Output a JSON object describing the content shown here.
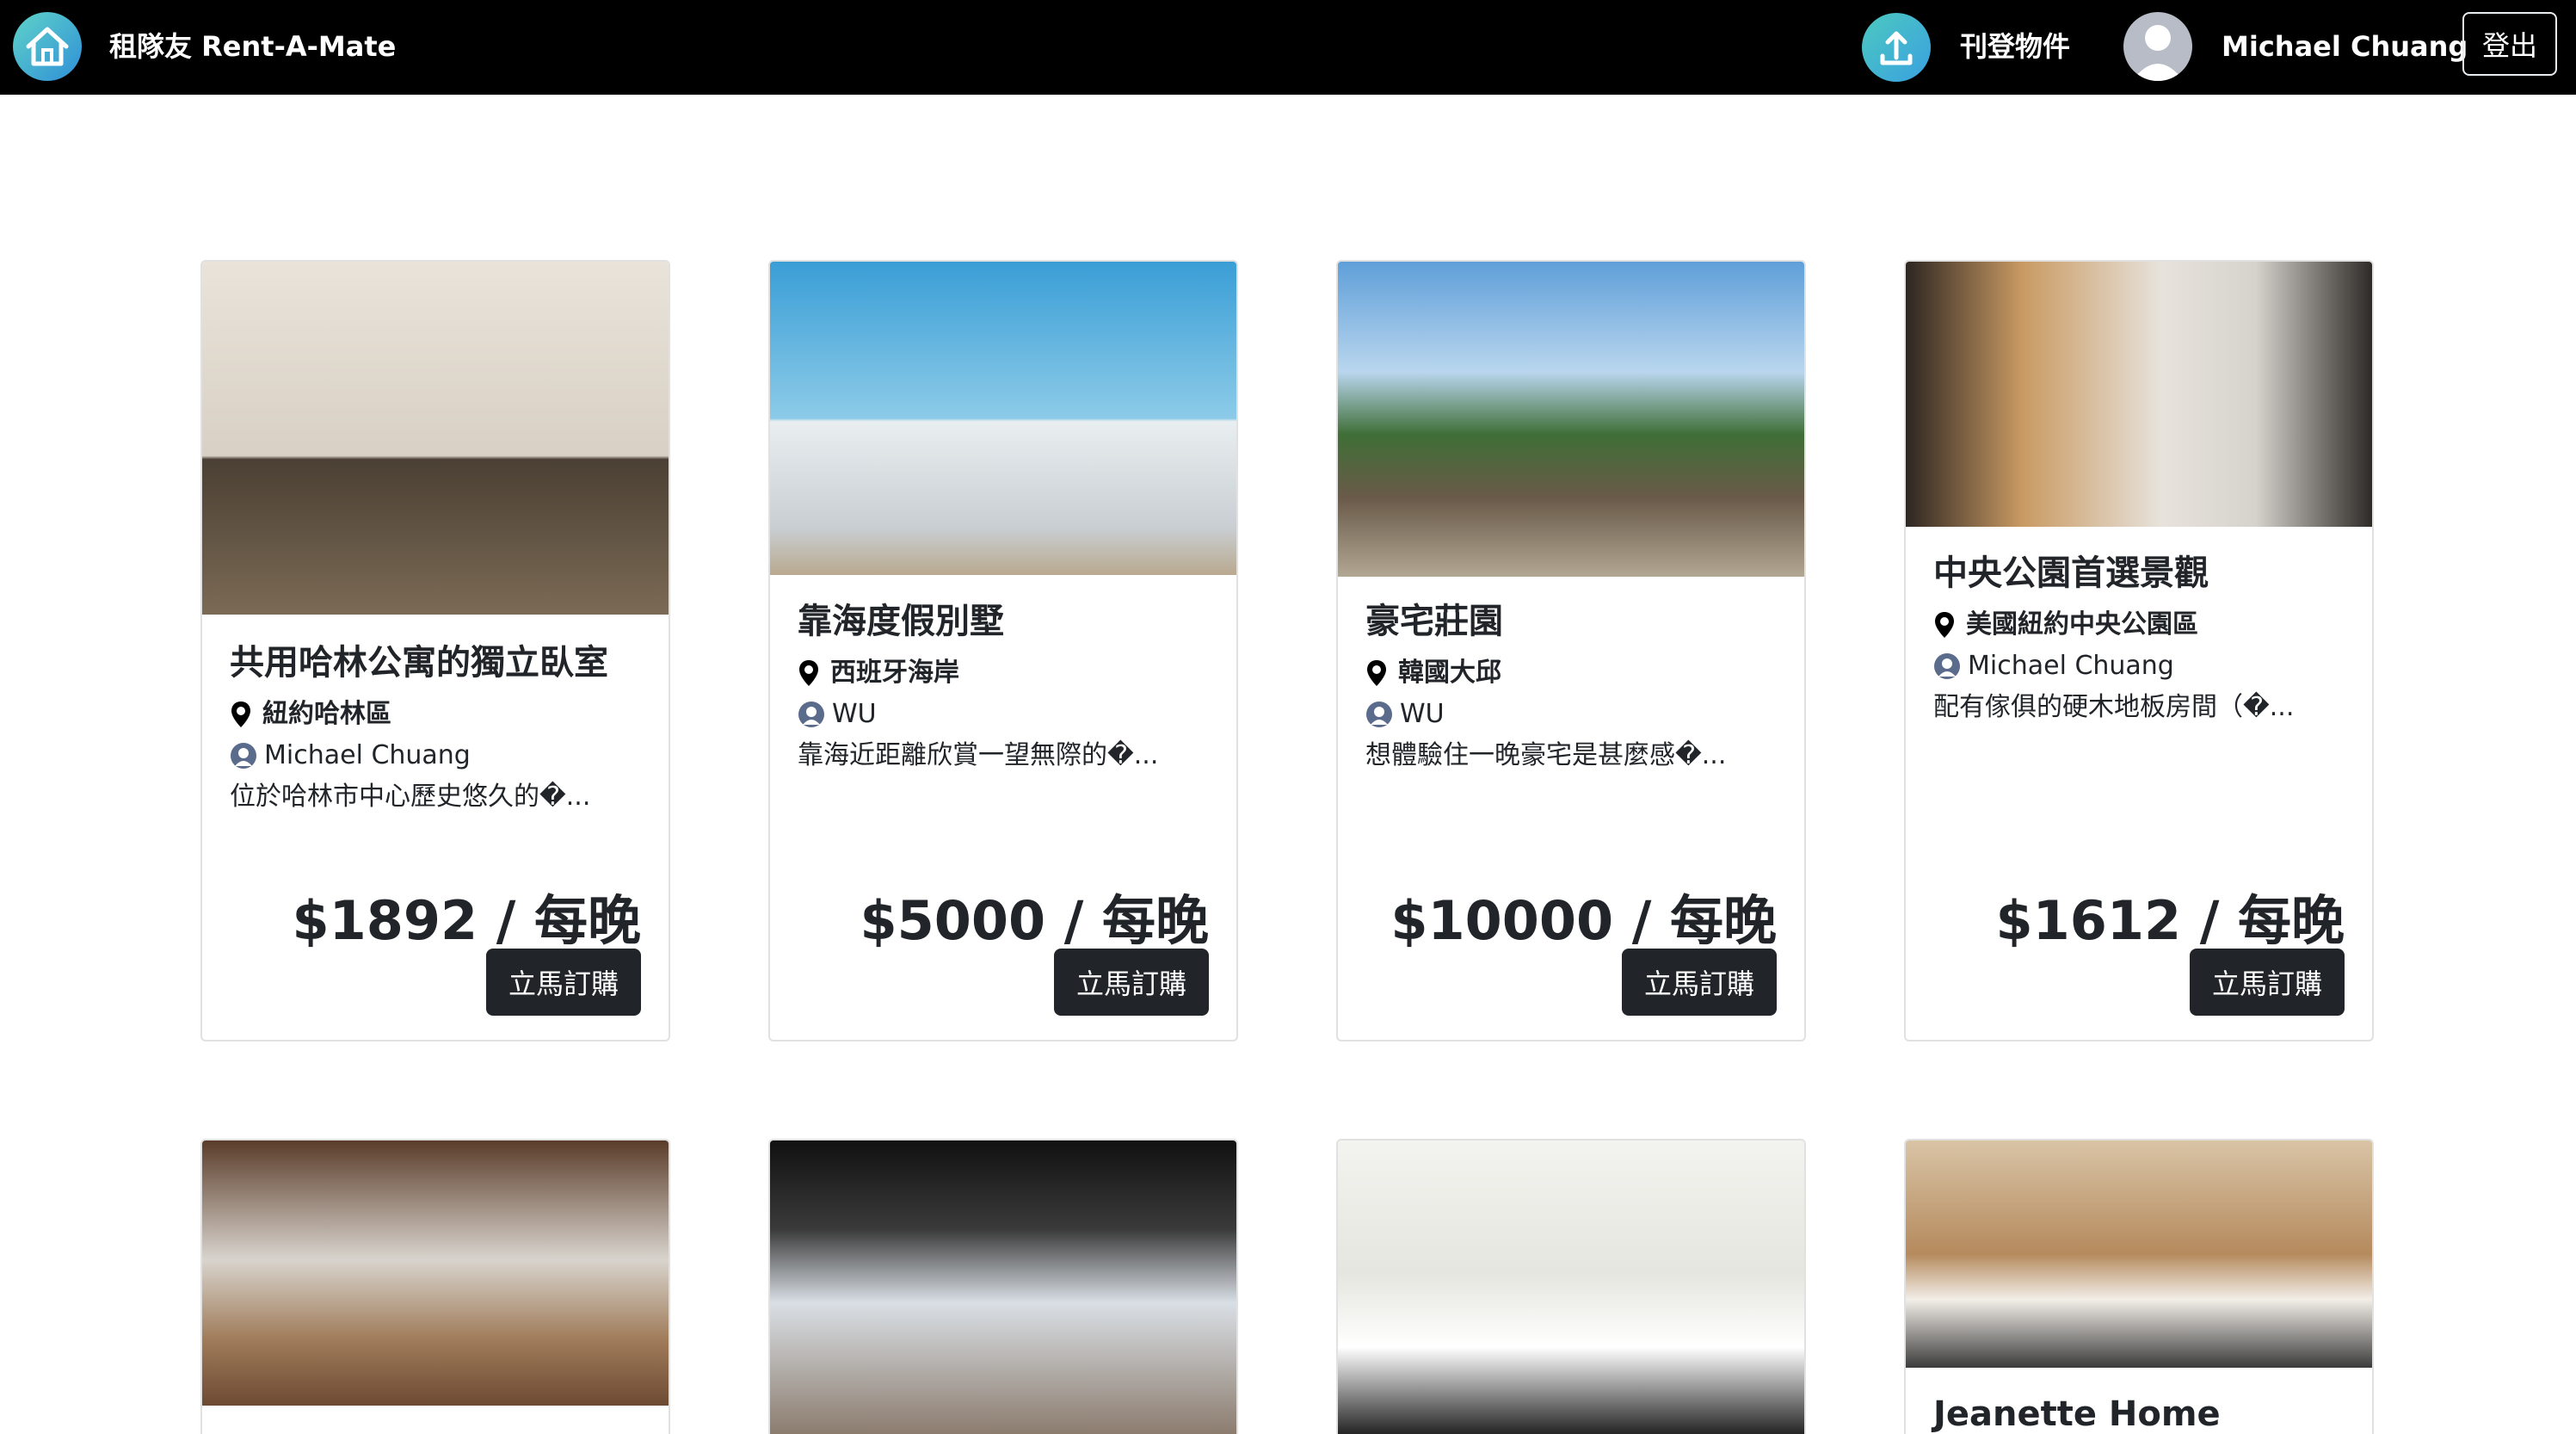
{
  "header": {
    "brand_name": "租隊友 Rent-A-Mate",
    "post_label": "刊登物件",
    "user_name": "Michael Chuang",
    "logout_label": "登出"
  },
  "listings": [
    {
      "title": "共用哈林公寓的獨立臥室",
      "location": "紐約哈林區",
      "host": "Michael Chuang",
      "description": "位於哈林市中心歷史悠久的�...",
      "price": "$1892 / 每晚",
      "book_label": "立馬訂購"
    },
    {
      "title": "靠海度假別墅",
      "location": "西班牙海岸",
      "host": "WU",
      "description": "靠海近距離欣賞一望無際的�...",
      "price": "$5000 / 每晚",
      "book_label": "立馬訂購"
    },
    {
      "title": "豪宅莊園",
      "location": "韓國大邱",
      "host": "WU",
      "description": "想體驗住一晚豪宅是甚麼感�...",
      "price": "$10000 / 每晚",
      "book_label": "立馬訂購"
    },
    {
      "title": "中央公園首選景觀",
      "location": "美國紐約中央公園區",
      "host": "Michael Chuang",
      "description": "配有傢俱的硬木地板房間（�...",
      "price": "$1612 / 每晚",
      "book_label": "立馬訂購"
    },
    {
      "title": ""
    },
    {
      "title": ""
    },
    {
      "title": ""
    },
    {
      "title": "Jeanette Home"
    }
  ]
}
